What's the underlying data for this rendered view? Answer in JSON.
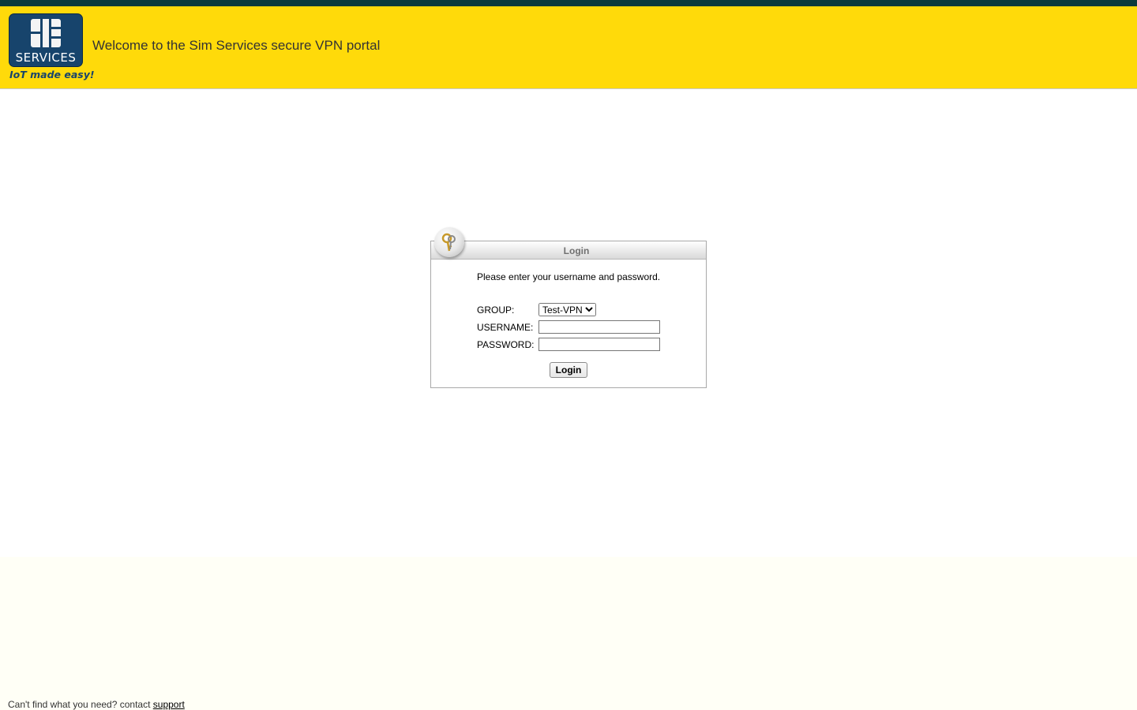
{
  "header": {
    "logo": {
      "icon": "sim-card-icon",
      "brand_text": "SERVICES",
      "tagline": "IoT made easy!"
    },
    "title": "Welcome to the Sim Services secure VPN portal"
  },
  "login": {
    "heading": "Login",
    "icon": "keys-icon",
    "prompt": "Please enter your username and password.",
    "group_label": "GROUP:",
    "group_value": "Test-VPN",
    "group_options": [
      "Test-VPN"
    ],
    "username_label": "USERNAME:",
    "username_value": "",
    "password_label": "PASSWORD:",
    "password_value": "",
    "submit_label": "Login"
  },
  "footer": {
    "text": "Can't find what you need? contact",
    "link_label": "support"
  },
  "colors": {
    "header_bg": "#ffda0a",
    "topbar": "#0b3a3c",
    "brand_blue": "#17446c"
  }
}
